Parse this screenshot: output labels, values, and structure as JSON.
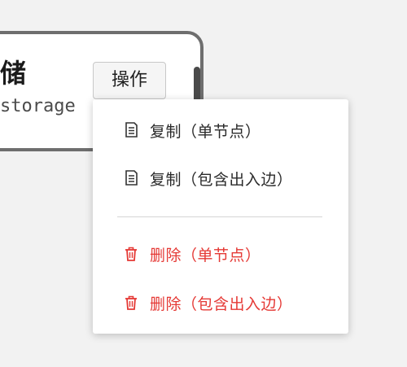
{
  "node": {
    "title": "储",
    "subtitle": "storage"
  },
  "toolbar": {
    "ops_label": "操作"
  },
  "menu": {
    "items": [
      {
        "label": "复制（单节点）",
        "icon": "copy-icon",
        "danger": false
      },
      {
        "label": "复制（包含出入边）",
        "icon": "copy-icon",
        "danger": false
      },
      {
        "label": "删除（单节点）",
        "icon": "trash-icon",
        "danger": true
      },
      {
        "label": "删除（包含出入边）",
        "icon": "trash-icon",
        "danger": true
      }
    ]
  },
  "colors": {
    "danger": "#e53935",
    "text": "#2a2a2a",
    "card_border": "#6e6e6e"
  }
}
